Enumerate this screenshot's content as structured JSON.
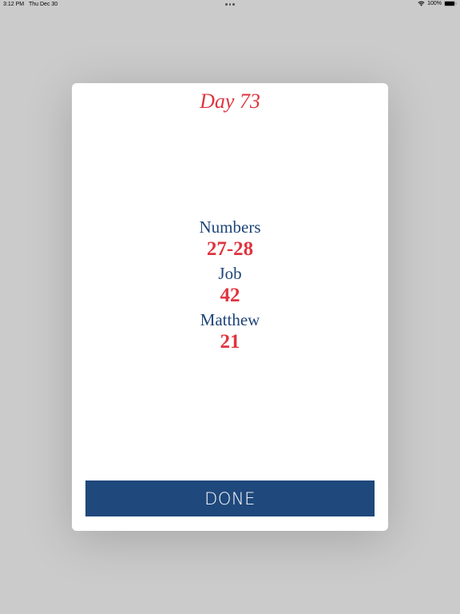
{
  "status_bar": {
    "time": "3:12 PM",
    "date": "Thu Dec 30",
    "battery": "100%"
  },
  "modal": {
    "title": "Day 73",
    "readings": [
      {
        "book": "Numbers",
        "chapters": "27-28"
      },
      {
        "book": "Job",
        "chapters": "42"
      },
      {
        "book": "Matthew",
        "chapters": "21"
      }
    ],
    "done_label": "DONE"
  },
  "colors": {
    "accent_red": "#e0343f",
    "navy": "#1f487c"
  }
}
